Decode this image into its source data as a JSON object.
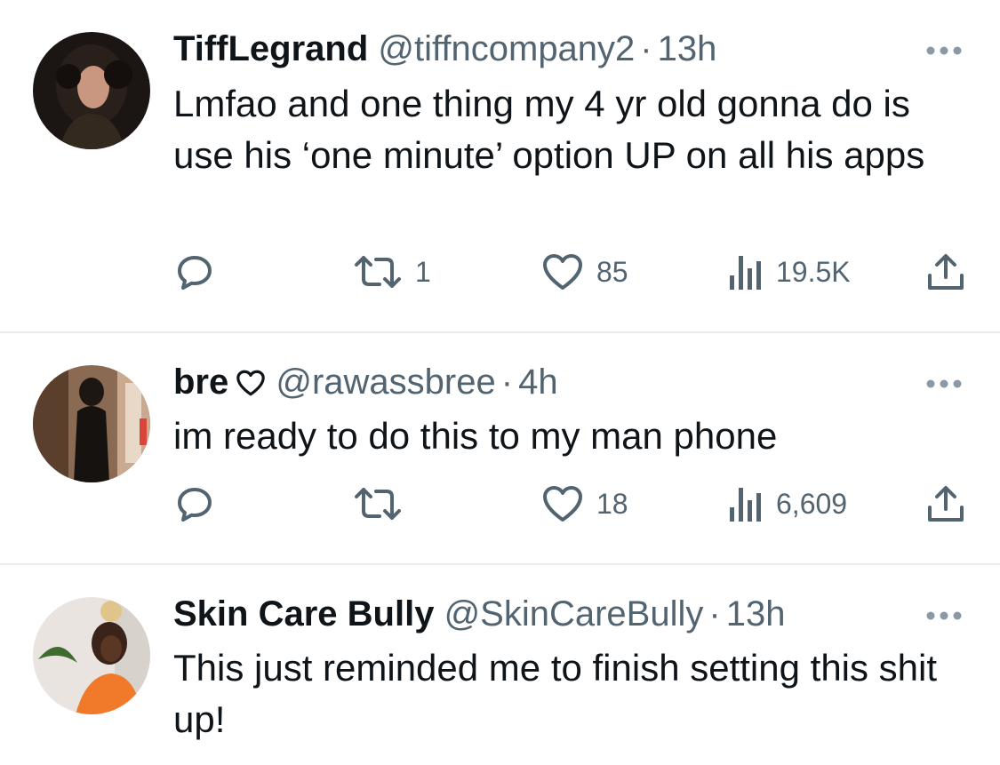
{
  "tweets": [
    {
      "name": "TiffLegrand",
      "handle": "@tiffncompany2",
      "sep": "·",
      "time": "13h",
      "text": "Lmfao and one thing my 4 yr old gonna do is use his ‘one minute’ option UP on all his apps",
      "reply_icon": "reply-icon",
      "retweets": "1",
      "likes": "85",
      "views": "19.5K"
    },
    {
      "name": "bre",
      "name_badge_icon": "heart-outline-icon",
      "handle": "@rawassbree",
      "sep": "·",
      "time": "4h",
      "text": "im ready to do this to my man phone",
      "retweets": "",
      "likes": "18",
      "views": "6,609"
    },
    {
      "name": "Skin Care Bully",
      "handle": "@SkinCareBully",
      "sep": "·",
      "time": "13h",
      "text": "This just reminded me to finish setting this shit up!"
    }
  ],
  "colors": {
    "text": "#0f1419",
    "secondary": "#536471",
    "divider": "#e6ecf0"
  }
}
